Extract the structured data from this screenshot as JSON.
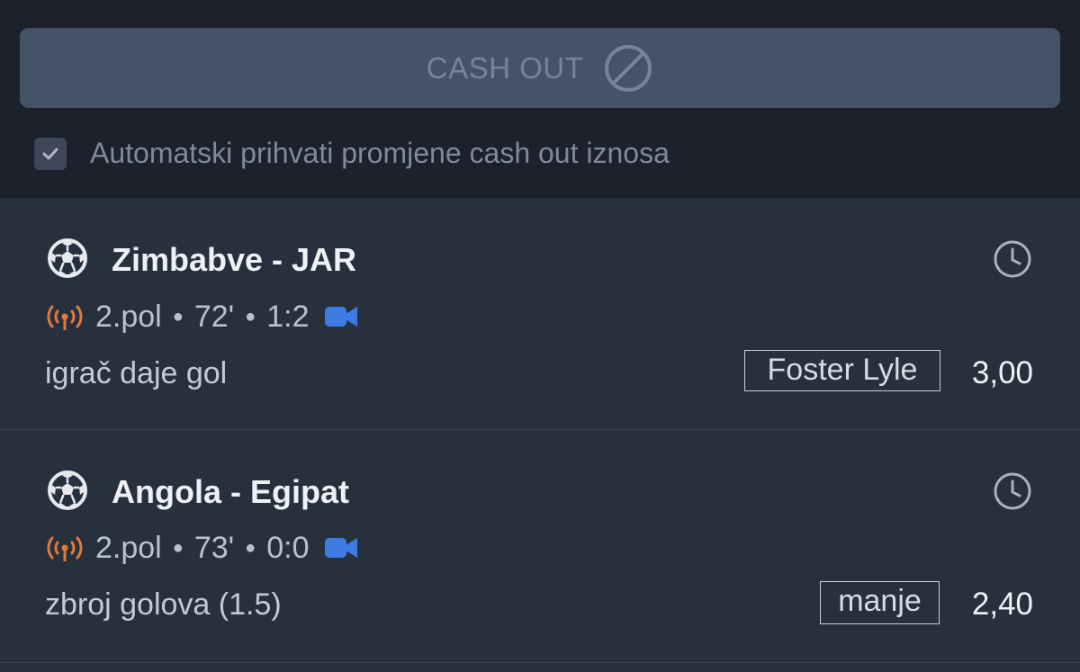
{
  "cashout": {
    "label": "CASH OUT",
    "icon": "ban-icon",
    "state": "disabled",
    "button_color": "#465266"
  },
  "auto_accept": {
    "checked": true,
    "label": "Automatski prihvati promjene cash out iznosa"
  },
  "bets": [
    {
      "sport_icon": "soccer-ball-icon",
      "match": "Zimbabve - JAR",
      "period": "2.pol",
      "minute": "72'",
      "score": "1:2",
      "market": "igrač daje gol",
      "pick": "Foster Lyle",
      "odds": "3,00"
    },
    {
      "sport_icon": "soccer-ball-icon",
      "match": "Angola - Egipat",
      "period": "2.pol",
      "minute": "73'",
      "score": "0:0",
      "market": "zbroj golova (1.5)",
      "pick": "manje",
      "odds": "2,40"
    }
  ],
  "colors": {
    "live_icon": "#e07a3a",
    "video_icon": "#3f7be4",
    "background_top": "#1c212b",
    "background_bets": "#27303d"
  }
}
